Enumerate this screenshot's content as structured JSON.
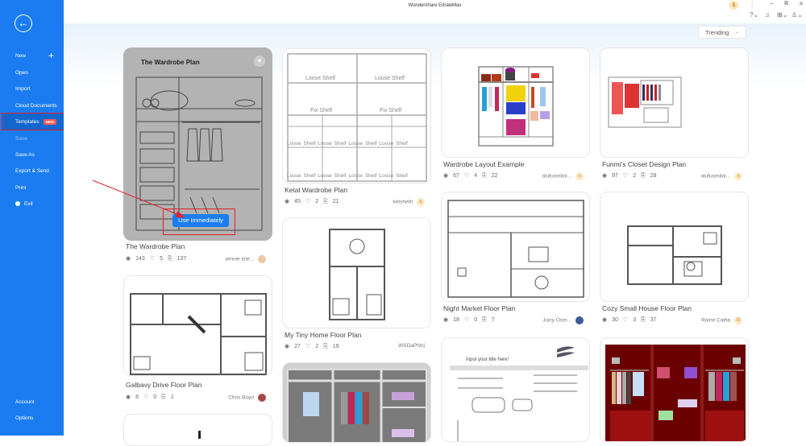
{
  "window": {
    "title": "Wondershare EdrawMax"
  },
  "sidebar": {
    "items": [
      {
        "label": "New"
      },
      {
        "label": "Open"
      },
      {
        "label": "Import"
      },
      {
        "label": "Cloud Documents"
      },
      {
        "label": "Templates",
        "badge": "NEW"
      },
      {
        "label": "Save"
      },
      {
        "label": "Save As"
      },
      {
        "label": "Export & Send"
      },
      {
        "label": "Print"
      },
      {
        "label": "Exit"
      }
    ],
    "bottom": [
      {
        "label": "Account"
      },
      {
        "label": "Options"
      }
    ]
  },
  "toolbar": {
    "notification_count": "1",
    "sort": "Trending"
  },
  "action": {
    "use_label": "Use Immediately"
  },
  "templates": [
    {
      "title": "The Wardrobe Plan",
      "thumb_title": "The Wardrobe Plan",
      "views": "143",
      "likes": "5",
      "copies": "137",
      "author": "winnie tzie...",
      "avatar": ""
    },
    {
      "title": "Galbavy Drive Floor Plan",
      "views": "8",
      "likes": "0",
      "copies": "1",
      "author": "Chris Boyd",
      "avatar": ""
    },
    {
      "title": "Ketal Wardrobe Plan",
      "views": "45",
      "likes": "2",
      "copies": "21",
      "author": "ketsheth",
      "avatar": "k"
    },
    {
      "title": "My Tiny Home Floor Plan",
      "views": "27",
      "likes": "2",
      "copies": "19",
      "author": "WSDaPNnj",
      "avatar": ""
    },
    {
      "title": "Wardrobe Layout Example",
      "views": "67",
      "likes": "4",
      "copies": "22",
      "author": "olufunmilol...",
      "avatar": "o"
    },
    {
      "title": "Night Market Floor Plan",
      "views": "18",
      "likes": "0",
      "copies": "7",
      "author": "Juicy Osm...",
      "avatar": ""
    },
    {
      "title": "Funmi's Closet Design Plan",
      "views": "97",
      "likes": "2",
      "copies": "28",
      "author": "olufunmilol...",
      "avatar": "o"
    },
    {
      "title": "Cozy Small House Floor Plan",
      "views": "30",
      "likes": "3",
      "copies": "37",
      "author": "Raine Caiña",
      "avatar": "R"
    }
  ],
  "ketal_labels": {
    "loose": "Loose Shelf",
    "fix": "Fix Shelf"
  },
  "form_thumb": {
    "title": "Input your title here!"
  },
  "colors": {
    "accent": "#1a7cf0",
    "highlight": "#e0222b"
  }
}
